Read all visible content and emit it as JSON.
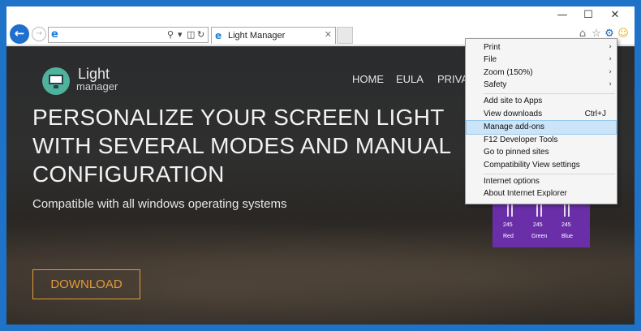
{
  "browser": {
    "tab_title": "Light Manager",
    "window_controls": {
      "minimize": "—",
      "maximize": "☐",
      "close": "✕"
    },
    "icons": {
      "back": "back-arrow-icon",
      "forward": "forward-arrow-icon",
      "search": "search-icon",
      "refresh": "refresh-icon",
      "home": "home-icon",
      "favorites": "star-icon",
      "tools": "gear-icon",
      "feedback": "smiley-icon"
    }
  },
  "site": {
    "logo_line1": "Light",
    "logo_line2": "manager",
    "nav": [
      "HOME",
      "EULA",
      "PRIVAC"
    ],
    "headline": "PERSONALIZE YOUR SCREEN LIGHT WITH SEVERAL MODES AND MANUAL CONFIGURATION",
    "subline": "Compatible with all windows operating systems",
    "download_label": "DOWNLOAD",
    "widget": {
      "values": [
        "245",
        "245",
        "245"
      ],
      "labels": [
        "Red",
        "Green",
        "Blue"
      ]
    }
  },
  "menu": {
    "items": [
      {
        "label": "Print",
        "arrow": "›"
      },
      {
        "label": "File",
        "arrow": "›"
      },
      {
        "label": "Zoom (150%)",
        "arrow": "›"
      },
      {
        "label": "Safety",
        "arrow": "›"
      },
      {
        "label": "Add site to Apps"
      },
      {
        "label": "View downloads",
        "shortcut": "Ctrl+J"
      },
      {
        "label": "Manage add-ons",
        "highlighted": true
      },
      {
        "label": "F12 Developer Tools"
      },
      {
        "label": "Go to pinned sites"
      },
      {
        "label": "Compatibility View settings"
      },
      {
        "label": "Internet options"
      },
      {
        "label": "About Internet Explorer"
      }
    ]
  },
  "colors": {
    "frame": "#1e72c8",
    "accent_orange": "#e39b3c",
    "highlight": "#cce4f7",
    "widget_purple": "#6a2fa8"
  }
}
